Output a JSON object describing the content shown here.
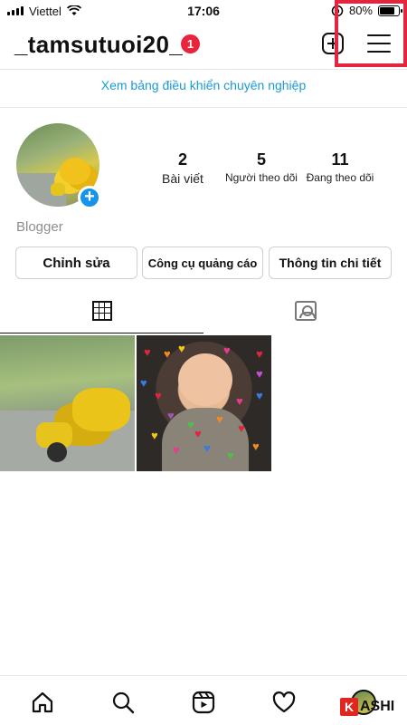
{
  "status_bar": {
    "carrier": "Viettel",
    "time": "17:06",
    "battery": "80%"
  },
  "header": {
    "username": "_tamsutuoi20_",
    "notification_count": "1"
  },
  "professional_link": "Xem bảng điều khiển chuyên nghiệp",
  "stats": {
    "posts": {
      "count": "2",
      "label": "Bài viết"
    },
    "followers": {
      "count": "5",
      "label": "Người theo dõi"
    },
    "following": {
      "count": "11",
      "label": "Đang theo dõi"
    }
  },
  "bio": "Blogger",
  "buttons": {
    "edit": "Chỉnh sửa",
    "ad_tools": "Công cụ quảng cáo",
    "insights": "Thông tin chi tiết"
  },
  "watermark": {
    "logo_letter": "K",
    "text": "ASHI"
  },
  "colors": {
    "accent_blue": "#1b9ad6",
    "badge_red": "#e8253d",
    "highlight_red": "#e3253f"
  }
}
